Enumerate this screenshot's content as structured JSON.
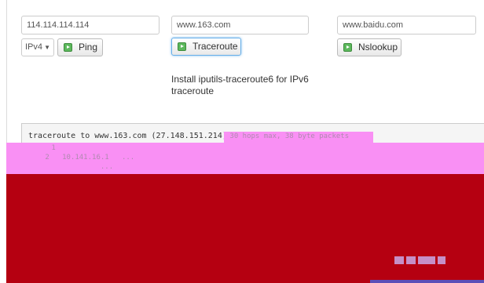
{
  "ping": {
    "host_value": "114.114.114.114",
    "protocol_selected": "IPv4",
    "button_label": "Ping"
  },
  "traceroute": {
    "host_value": "www.163.com",
    "button_label": "Traceroute",
    "hint": "Install iputils-traceroute6 for IPv6 traceroute"
  },
  "nslookup": {
    "host_value": "www.baidu.com",
    "button_label": "Nslookup"
  },
  "output": {
    "line1": "traceroute to www.163.com (27.148.151.214)",
    "line1_redacted": " 30 hops max, 38 byte packets",
    "line2_redacted": " 1",
    "line3_redacted": " 2   10.141.16.1   ...",
    "line4_redacted": "              ..."
  },
  "colors": {
    "redaction_pink": "#f990f4",
    "redaction_red": "#b50011",
    "button_icon_green": "#5cb85c"
  }
}
